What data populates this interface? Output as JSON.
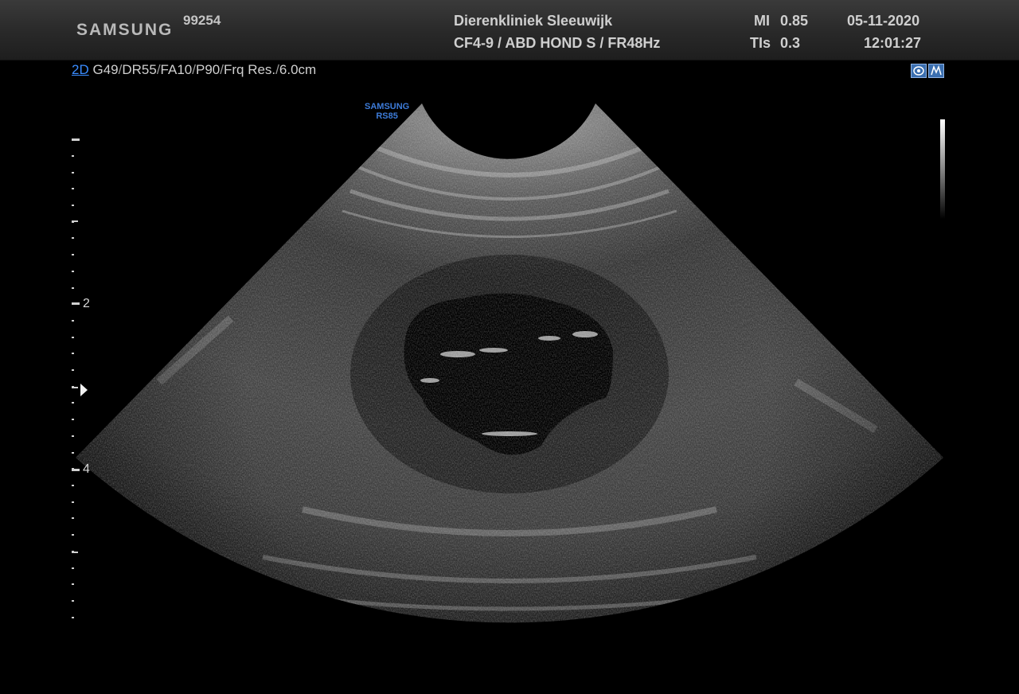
{
  "header": {
    "brand": "SAMSUNG",
    "patient_id": "99254",
    "clinic": "Dierenkliniek Sleeuwijk",
    "probe_preset": "CF4-9 / ABD HOND S / FR48Hz",
    "mi_label": "MI",
    "mi_value": "0.85",
    "tis_label": "TIs",
    "tis_value": "0.3",
    "date": "05-11-2020",
    "time": "12:01:27"
  },
  "imaging": {
    "mode": "2D",
    "params": [
      "G49",
      "DR55",
      "FA10",
      "P90",
      "Frq Res.",
      "6.0cm"
    ],
    "probe_logo_line1": "SAMSUNG",
    "probe_logo_line2": "RS85"
  },
  "depth_scale": {
    "labels": [
      "2",
      "4"
    ]
  },
  "icons": [
    "biopsy-guide-icon",
    "measurement-icon"
  ]
}
